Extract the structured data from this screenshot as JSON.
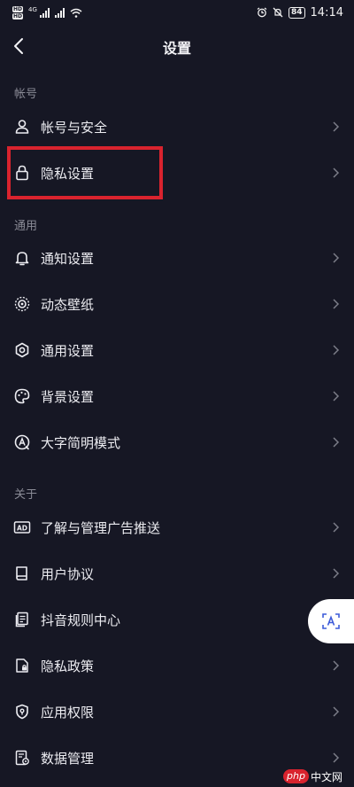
{
  "status_bar": {
    "network_label": "4G",
    "battery": "84",
    "time": "14:14"
  },
  "header": {
    "title": "设置"
  },
  "sections": [
    {
      "title": "帐号",
      "items": [
        {
          "label": "帐号与安全",
          "icon": "user-icon"
        },
        {
          "label": "隐私设置",
          "icon": "lock-icon"
        }
      ]
    },
    {
      "title": "通用",
      "items": [
        {
          "label": "通知设置",
          "icon": "bell-icon"
        },
        {
          "label": "动态壁纸",
          "icon": "live-wallpaper-icon"
        },
        {
          "label": "通用设置",
          "icon": "gear-icon"
        },
        {
          "label": "背景设置",
          "icon": "palette-icon"
        },
        {
          "label": "大字简明模式",
          "icon": "large-font-icon"
        }
      ]
    },
    {
      "title": "关于",
      "items": [
        {
          "label": "了解与管理广告推送",
          "icon": "ad-icon"
        },
        {
          "label": "用户协议",
          "icon": "book-icon"
        },
        {
          "label": "抖音规则中心",
          "icon": "document-icon"
        },
        {
          "label": "隐私政策",
          "icon": "privacy-policy-icon"
        },
        {
          "label": "应用权限",
          "icon": "shield-icon"
        },
        {
          "label": "数据管理",
          "icon": "data-management-icon"
        }
      ]
    }
  ],
  "watermark": {
    "logo_text": "php",
    "site_text": "中文网"
  },
  "colors": {
    "background": "#161724",
    "highlight": "#d9232e",
    "section_header": "#8a8b96"
  }
}
